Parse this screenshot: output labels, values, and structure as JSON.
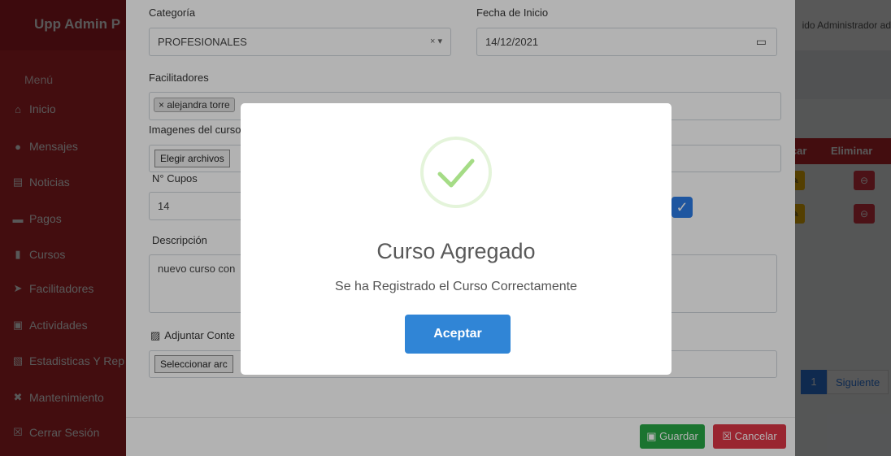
{
  "app": {
    "brand": "Upp Admin P",
    "admin_text": "ido Administrador ad"
  },
  "sidebar": {
    "title": "Menú",
    "items": [
      {
        "label": "Inicio",
        "icon": "home-icon"
      },
      {
        "label": "Mensajes",
        "icon": "comment-icon"
      },
      {
        "label": "Noticias",
        "icon": "newspaper-icon"
      },
      {
        "label": "Pagos",
        "icon": "money-icon"
      },
      {
        "label": "Cursos",
        "icon": "book-icon"
      },
      {
        "label": "Facilitadores",
        "icon": "bullhorn-icon"
      },
      {
        "label": "Actividades",
        "icon": "image-icon"
      },
      {
        "label": "Estadisticas Y Rep",
        "icon": "pdf-icon"
      },
      {
        "label": "Mantenimiento",
        "icon": "tools-icon"
      },
      {
        "label": "Cerrar Sesión",
        "icon": "close-box-icon"
      }
    ]
  },
  "table": {
    "col_modificar": "ficar",
    "col_eliminar": "Eliminar"
  },
  "pager": {
    "page": "1",
    "next": "Siguiente"
  },
  "form": {
    "categoria_label": "Categoría",
    "categoria_value": "PROFESIONALES",
    "fecha_label": "Fecha de Inicio",
    "fecha_value": "14/12/2021",
    "facilitadores_label": "Facilitadores",
    "facilitador_tag": "× alejandra torre",
    "imagenes_label": "Imagenes del curso",
    "elegir_archivos": "Elegir archivos",
    "cupos_label": "N° Cupos",
    "cupos_value": "14",
    "descripcion_label": "Descripción",
    "descripcion_value": "nuevo curso con",
    "adjuntar_label": "Adjuntar Conte",
    "seleccionar_archivo": "Seleccionar arc",
    "guardar": "Guardar",
    "cancelar": "Cancelar"
  },
  "alert": {
    "title": "Curso Agregado",
    "message": "Se ha Registrado el Curso Correctamente",
    "ok": "Aceptar"
  }
}
